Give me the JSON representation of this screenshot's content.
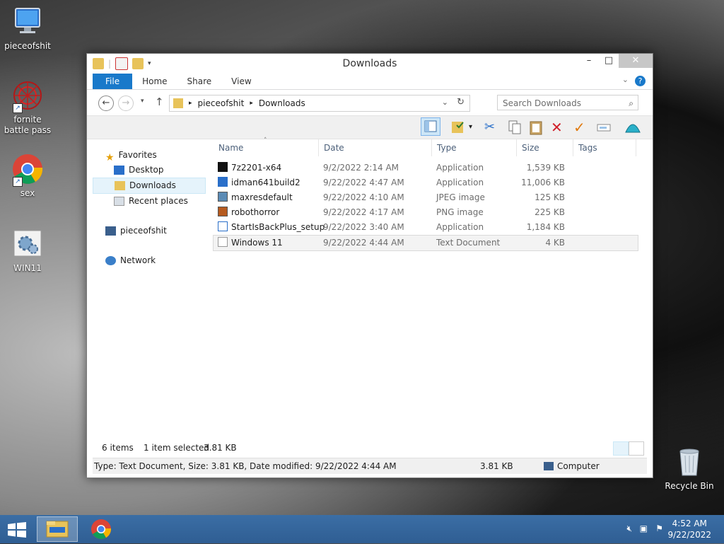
{
  "desktop": {
    "icons": [
      {
        "label": "pieceofshit"
      },
      {
        "label": "fornite battle pass"
      },
      {
        "label": "sex"
      },
      {
        "label": "WIN11"
      },
      {
        "label": "Recycle Bin"
      }
    ]
  },
  "window": {
    "title": "Downloads",
    "ribbon_tabs": [
      "File",
      "Home",
      "Share",
      "View"
    ],
    "address": {
      "segments": [
        "pieceofshit",
        "Downloads"
      ]
    },
    "search": {
      "placeholder": "Search Downloads"
    },
    "nav": {
      "favorites": "Favorites",
      "desktop": "Desktop",
      "downloads": "Downloads",
      "recent": "Recent places",
      "computer": "pieceofshit",
      "network": "Network"
    },
    "columns": [
      "Name",
      "Date",
      "Type",
      "Size",
      "Tags"
    ],
    "files": [
      {
        "name": "7z2201-x64",
        "date": "9/2/2022 2:14 AM",
        "type": "Application",
        "size": "1,539 KB",
        "icon": "7zip-icon"
      },
      {
        "name": "idman641build2",
        "date": "9/22/2022 4:47 AM",
        "type": "Application",
        "size": "11,006 KB",
        "icon": "idm-icon"
      },
      {
        "name": "maxresdefault",
        "date": "9/22/2022 4:10 AM",
        "type": "JPEG image",
        "size": "125 KB",
        "icon": "image-icon"
      },
      {
        "name": "robothorror",
        "date": "9/22/2022 4:17 AM",
        "type": "PNG image",
        "size": "225 KB",
        "icon": "image-icon"
      },
      {
        "name": "StartIsBackPlus_setup",
        "date": "9/22/2022 3:40 AM",
        "type": "Application",
        "size": "1,184 KB",
        "icon": "installer-icon"
      },
      {
        "name": "Windows 11",
        "date": "9/22/2022 4:44 AM",
        "type": "Text Document",
        "size": "4 KB",
        "icon": "text-file-icon"
      }
    ],
    "status": {
      "items": "6 items",
      "selected": "1 item selected",
      "selected_size": "3.81 KB"
    },
    "details": {
      "text": "Type: Text Document, Size: 3.81 KB, Date modified: 9/22/2022 4:44 AM",
      "size": "3.81 KB",
      "location": "Computer"
    }
  },
  "taskbar": {
    "time": "4:52 AM",
    "date": "9/22/2022"
  },
  "colors": {
    "accent": "#1979ca",
    "taskbar": "#3366a0",
    "selection": "#e5f3fb"
  }
}
